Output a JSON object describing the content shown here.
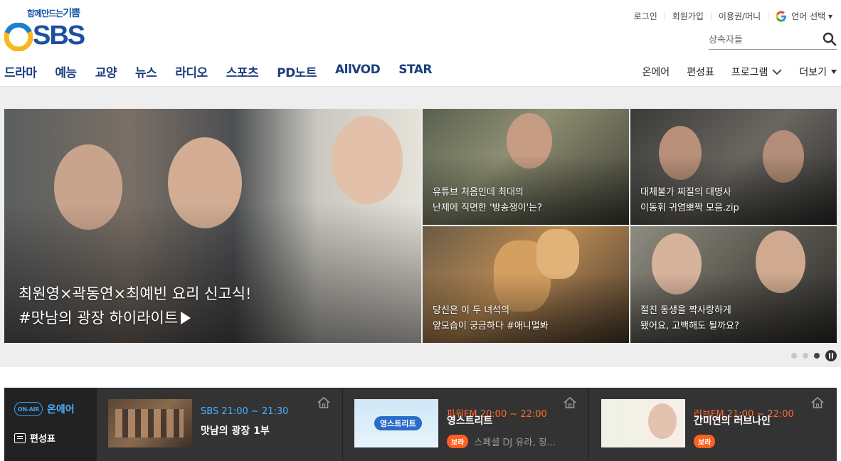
{
  "brand": {
    "tagline_main": "함께만드는",
    "tagline_accent": "기쁨",
    "logo_text": "SBS"
  },
  "util": {
    "login": "로그인",
    "join": "회원가입",
    "voucher": "이용권/머니",
    "language": "언어 선택 ▾"
  },
  "search": {
    "placeholder": "상속자들"
  },
  "gnb": {
    "items": [
      "드라마",
      "예능",
      "교양",
      "뉴스",
      "라디오",
      "스포츠",
      "PD노트",
      "AllVOD",
      "STAR"
    ]
  },
  "gnb_right": {
    "onair": "온에어",
    "schedule": "편성표",
    "programs": "프로그램",
    "more": "더보기"
  },
  "hero": {
    "big": {
      "line1": "최원영×곽동연×최예빈 요리 신고식!",
      "line2": "#맛남의 광장 하이라이트"
    },
    "tiles": [
      {
        "line1": "유튜브 처음인데 최대의",
        "line2": "난제에 직면한 '방송쟁이'는?"
      },
      {
        "line1": "대체불가 찌질의 대명사",
        "line2": "이동휘 귀염뽀짝 모음.zip"
      },
      {
        "line1": "당신은 이 두 녀석의",
        "line2": "앞모습이 궁금하다 #애니멀봐"
      },
      {
        "line1": "절친 동생을 짝사랑하게",
        "line2": "됐어요, 고백해도 될까요?"
      }
    ],
    "slide_count": 4,
    "active_slide": 3
  },
  "onair": {
    "live_badge": "ON-AIR",
    "live_label": "온에어",
    "schedule_label": "편성표",
    "channels": [
      {
        "time": "SBS 21:00 ~ 21:30",
        "title": "맛남의 광장 1부",
        "time_color": "#4ab0ff",
        "sub": "",
        "bora": ""
      },
      {
        "time": "파워FM 20:00 ~ 22:00",
        "title": "영스트리트",
        "time_color": "#ff6a2c",
        "sub": "스페셜 DJ 유라, 정...",
        "bora": "보라",
        "thumb_text": "영스트리트"
      },
      {
        "time": "러브FM 21:00 ~ 22:00",
        "title": "간미연의 러브나인",
        "time_color": "#ff6a2c",
        "sub": "",
        "bora": "보라"
      }
    ]
  },
  "colors": {
    "brand_blue": "#1b4fa0",
    "onair_blue": "#4ab0ff",
    "radio_orange": "#ff6a2c",
    "bora_badge": "#ff5f1f"
  }
}
